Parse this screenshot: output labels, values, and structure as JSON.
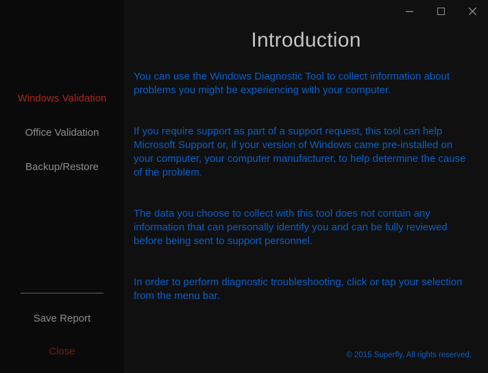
{
  "sidebar": {
    "items": [
      {
        "label": "Windows Validation",
        "active": true
      },
      {
        "label": "Office Validation",
        "active": false
      },
      {
        "label": "Backup/Restore",
        "active": false
      }
    ],
    "save_report": "Save Report",
    "close": "Close"
  },
  "window": {
    "minimize": "minimize",
    "maximize": "maximize",
    "close": "close"
  },
  "main": {
    "heading": "Introduction",
    "paragraphs": [
      "You can use the Windows Diagnostic Tool to collect information about problems you might be experiencing with your computer.",
      "If you require support as part of a support request, this tool can help Microsoft Support or, if your version of Windows came pre-installed on your computer, your computer manufacturer, to help determine the cause of the problem.",
      "The data you choose to collect with this tool does not contain any information that can personally identify you and can be fully reviewed before being sent to support personnel.",
      "In order to perform diagnostic troubleshooting, click or tap your selection from the menu bar."
    ],
    "footer": "© 2015 Superfly. All rights reserved."
  }
}
